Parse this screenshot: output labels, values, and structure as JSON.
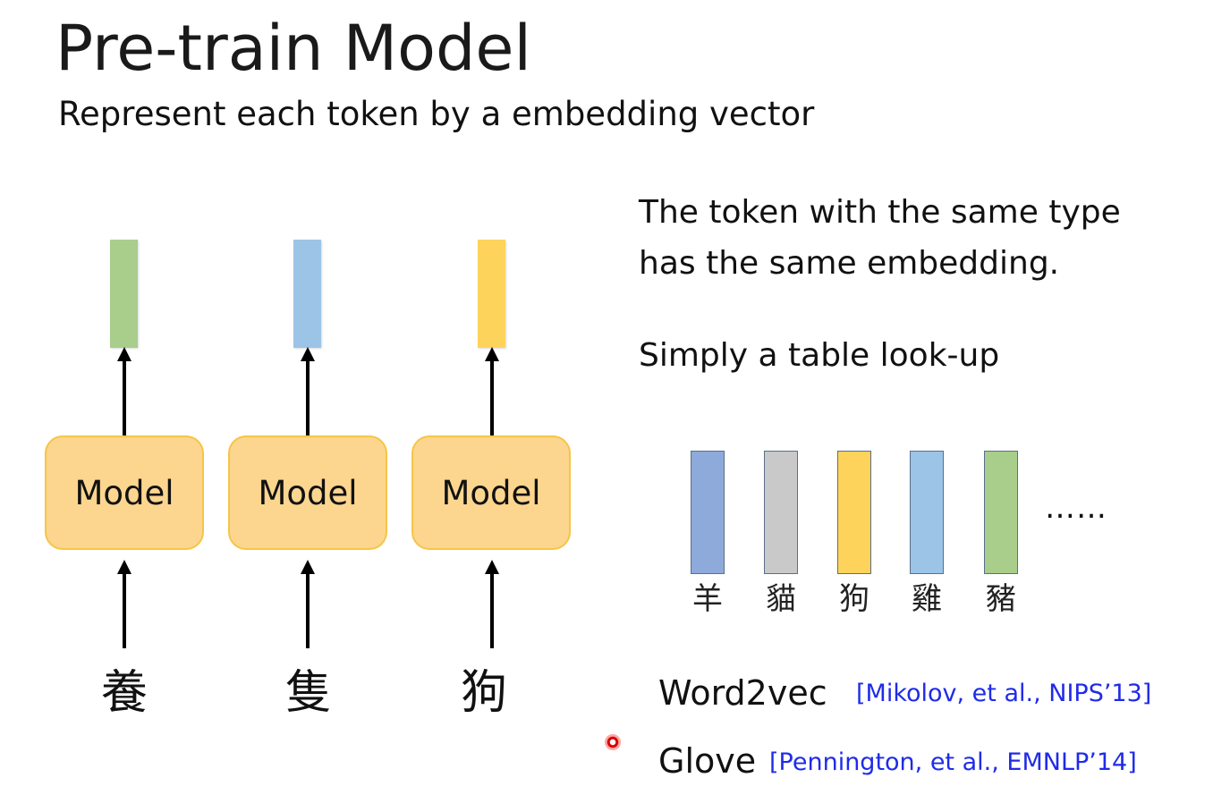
{
  "slide": {
    "title": "Pre-train Model",
    "subtitle": "Represent each token by a embedding vector"
  },
  "diagram": {
    "model_label": "Model",
    "tokens": [
      "養",
      "隻",
      "狗"
    ],
    "embedding_colors": [
      "#a9cd8b",
      "#9cc4e6",
      "#fdd35c"
    ],
    "box_fill": "#fcd58f",
    "box_border": "#f6c547"
  },
  "notes": {
    "line1": "The token with the same type",
    "line2": "has the same embedding.",
    "line3": "Simply a table look-up"
  },
  "lookup_table": {
    "entries": [
      {
        "label": "羊",
        "color": "#8eaadb"
      },
      {
        "label": "貓",
        "color": "#c9c9c9"
      },
      {
        "label": "狗",
        "color": "#fdd35c"
      },
      {
        "label": "雞",
        "color": "#9cc4e6"
      },
      {
        "label": "豬",
        "color": "#a9cd8b"
      }
    ],
    "ellipsis": "……"
  },
  "references": [
    {
      "name": "Word2vec",
      "citation": "[Mikolov, et al., NIPS’13]"
    },
    {
      "name": "Glove",
      "citation": "[Pennington, et al., EMNLP’14]"
    }
  ]
}
